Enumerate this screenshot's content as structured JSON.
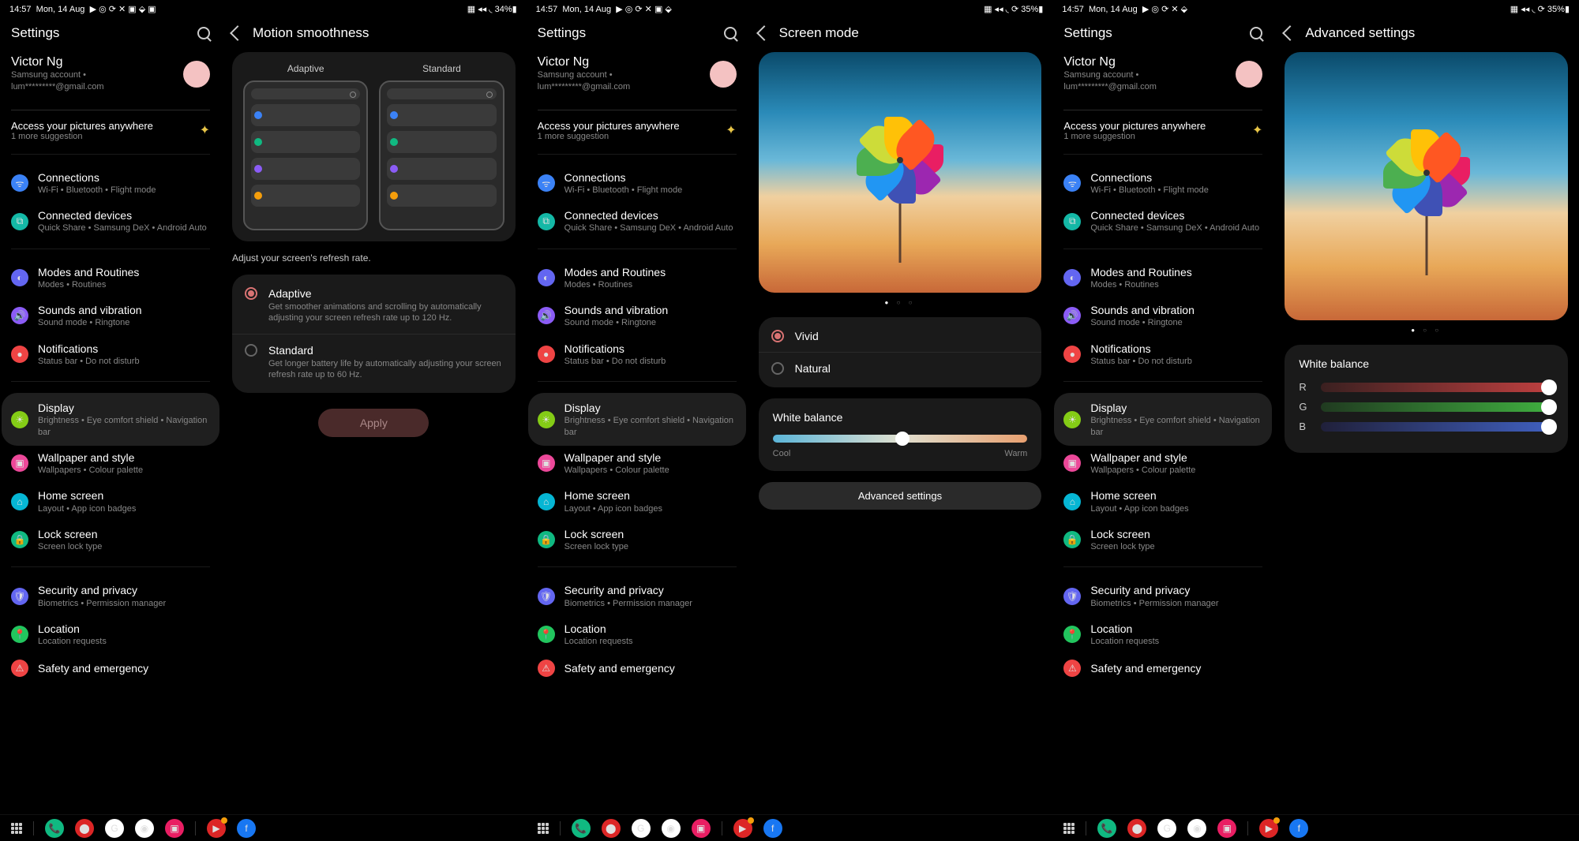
{
  "status": {
    "time": "14:57",
    "date": "Mon, 14 Aug",
    "battery1": "34%",
    "battery2": "35%"
  },
  "settings_title": "Settings",
  "account": {
    "name": "Victor Ng",
    "sub1": "Samsung account  •",
    "sub2": "lum*********@gmail.com"
  },
  "suggestion": {
    "title": "Access your pictures anywhere",
    "more": "1 more suggestion"
  },
  "items": {
    "connections": {
      "title": "Connections",
      "sub": "Wi-Fi  •  Bluetooth  •  Flight mode"
    },
    "connected": {
      "title": "Connected devices",
      "sub": "Quick Share  •  Samsung DeX  •  Android Auto"
    },
    "modes": {
      "title": "Modes and Routines",
      "sub": "Modes  •  Routines"
    },
    "sounds": {
      "title": "Sounds and vibration",
      "sub": "Sound mode  •  Ringtone"
    },
    "notif": {
      "title": "Notifications",
      "sub": "Status bar  •  Do not disturb"
    },
    "display": {
      "title": "Display",
      "sub": "Brightness  •  Eye comfort shield  •  Navigation bar"
    },
    "wallpaper": {
      "title": "Wallpaper and style",
      "sub": "Wallpapers  •  Colour palette"
    },
    "home": {
      "title": "Home screen",
      "sub": "Layout  •  App icon badges"
    },
    "lock": {
      "title": "Lock screen",
      "sub": "Screen lock type"
    },
    "security": {
      "title": "Security and privacy",
      "sub": "Biometrics  •  Permission manager"
    },
    "location": {
      "title": "Location",
      "sub": "Location requests"
    },
    "safety": {
      "title": "Safety and emergency"
    }
  },
  "motion": {
    "heading": "Motion smoothness",
    "adaptive_lbl": "Adaptive",
    "standard_lbl": "Standard",
    "hint": "Adjust your screen's refresh rate.",
    "adaptive_title": "Adaptive",
    "adaptive_sub": "Get smoother animations and scrolling by automatically adjusting your screen refresh rate up to 120 Hz.",
    "standard_title": "Standard",
    "standard_sub": "Get longer battery life by automatically adjusting your screen refresh rate up to 60 Hz.",
    "apply": "Apply"
  },
  "screenmode": {
    "heading": "Screen mode",
    "vivid": "Vivid",
    "natural": "Natural",
    "wb": "White balance",
    "cool": "Cool",
    "warm": "Warm",
    "advanced": "Advanced settings"
  },
  "advanced": {
    "heading": "Advanced settings",
    "wb": "White balance",
    "r": "R",
    "g": "G",
    "b": "B"
  }
}
